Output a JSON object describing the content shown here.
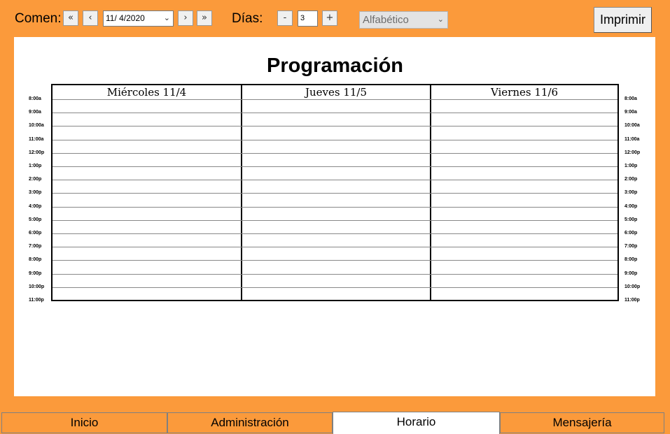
{
  "toolbar": {
    "start_label": "Comen:",
    "btn_first": "«",
    "btn_prev": "‹",
    "date_value": "11/ 4/2020",
    "btn_next": "›",
    "btn_last": "»",
    "days_label": "Días:",
    "minus_label": "-",
    "days_value": "3",
    "plus_label": "+",
    "sort_value": "Alfabético",
    "print_label": "Imprimir"
  },
  "schedule": {
    "title": "Programación",
    "columns": [
      "Miércoles 11/4",
      "Jueves 11/5",
      "Viernes 11/6"
    ],
    "times": [
      "8:00a",
      "9:00a",
      "10:00a",
      "11:00a",
      "12:00p",
      "1:00p",
      "2:00p",
      "3:00p",
      "4:00p",
      "5:00p",
      "6:00p",
      "7:00p",
      "8:00p",
      "9:00p",
      "10:00p",
      "11:00p"
    ]
  },
  "tabs": [
    {
      "label": "Inicio",
      "active": false
    },
    {
      "label": "Administración",
      "active": false
    },
    {
      "label": "Horario",
      "active": true
    },
    {
      "label": "Mensajería",
      "active": false
    }
  ],
  "colors": {
    "background": "#fb9a3b",
    "panel": "#ffffff"
  }
}
